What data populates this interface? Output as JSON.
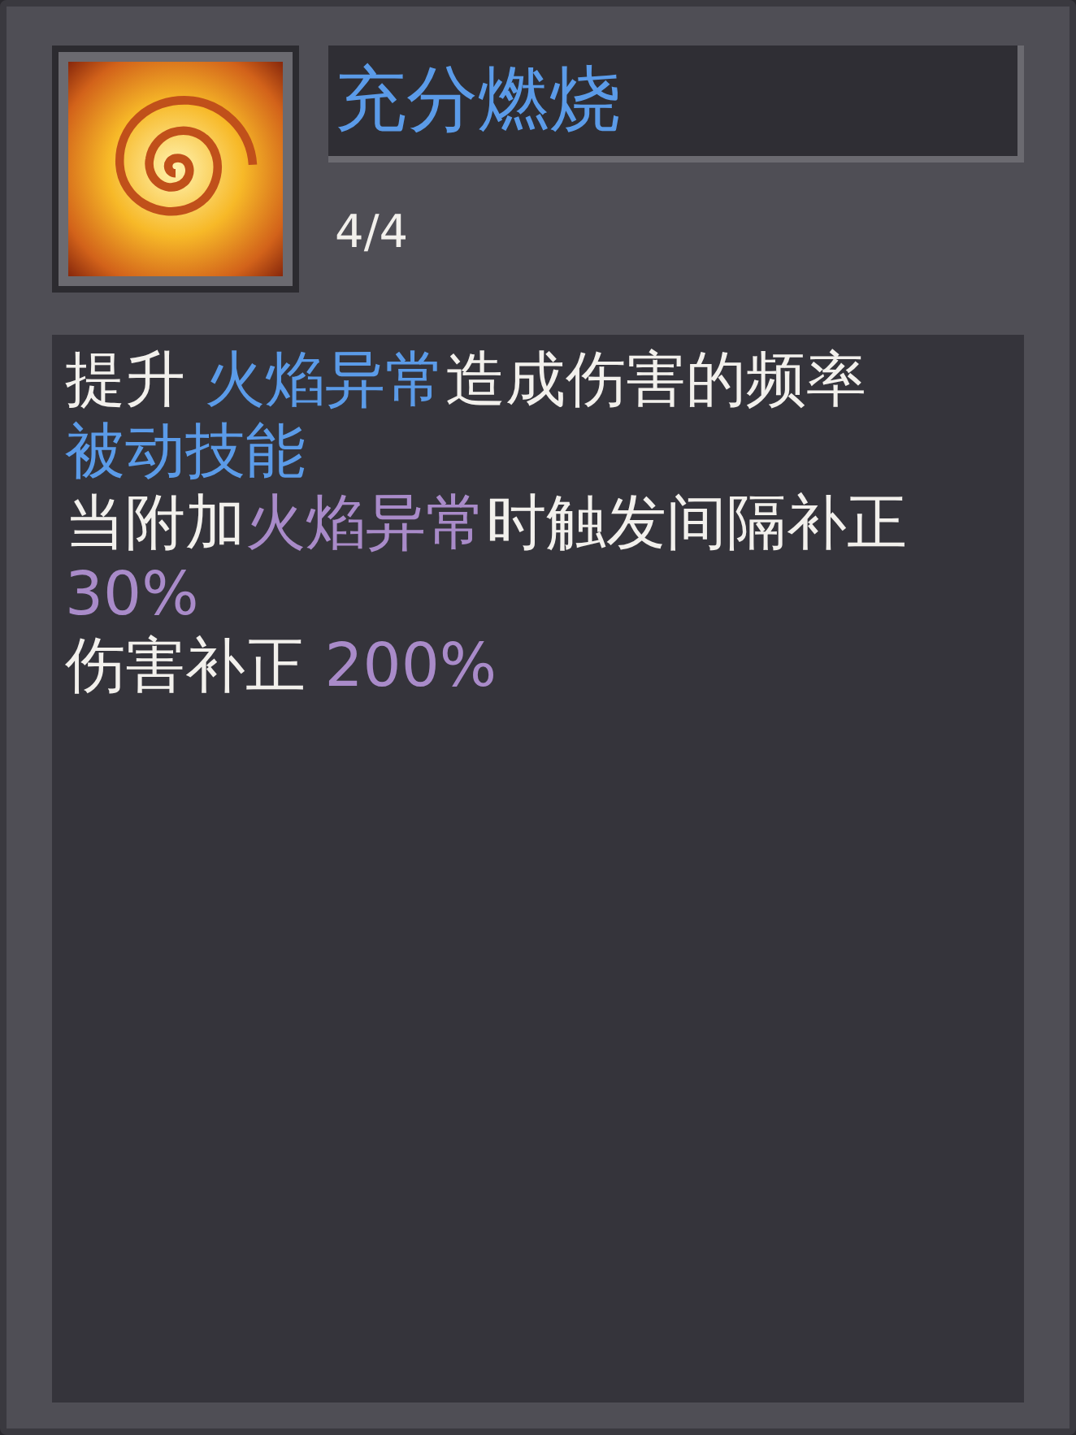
{
  "skill": {
    "name": "充分燃烧",
    "rank": "4/4"
  },
  "description": [
    {
      "segments": [
        {
          "text": "提升 ",
          "color": "#f2f0ec"
        },
        {
          "text": "火焰异常",
          "color": "#5b9be8"
        },
        {
          "text": "造成伤害的频率",
          "color": "#f2f0ec"
        }
      ]
    },
    {
      "segments": [
        {
          "text": "被动技能",
          "color": "#5b9be8"
        }
      ]
    },
    {
      "segments": [
        {
          "text": "当附加",
          "color": "#f2f0ec"
        },
        {
          "text": "火焰异常",
          "color": "#a98bc9"
        },
        {
          "text": "时触发间隔补正 ",
          "color": "#f2f0ec"
        },
        {
          "text": "30%",
          "color": "#a98bc9"
        }
      ]
    },
    {
      "segments": [
        {
          "text": "伤害补正 ",
          "color": "#f2f0ec"
        },
        {
          "text": "200%",
          "color": "#a98bc9"
        }
      ]
    }
  ]
}
